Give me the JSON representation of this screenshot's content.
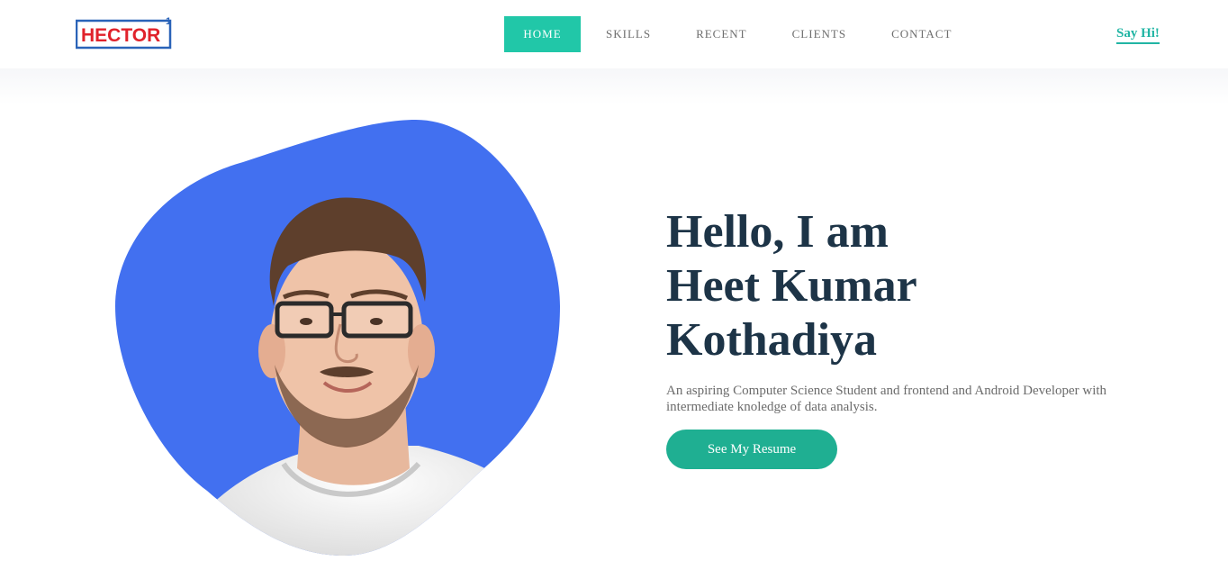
{
  "header": {
    "logo_text": "HECTOR",
    "logo_superscript": "1",
    "nav": [
      {
        "label": "HOME",
        "active": true
      },
      {
        "label": "SKILLS",
        "active": false
      },
      {
        "label": "RECENT",
        "active": false
      },
      {
        "label": "CLIENTS",
        "active": false
      },
      {
        "label": "CONTACT",
        "active": false
      }
    ],
    "say_hi": "Say Hi!"
  },
  "hero": {
    "title_lines": [
      "Hello, I am",
      "Heet Kumar",
      "Kothadiya"
    ],
    "description": "An aspiring Computer Science Student and frontend and Android Developer with intermediate knoledge of data analysis.",
    "resume_button": "See My Resume",
    "photo_icon": "person-photo"
  },
  "colors": {
    "accent": "#21c7a8",
    "button": "#1faf92",
    "blob": "#4270f0",
    "heading": "#1d3447",
    "logo_red": "#e0222b",
    "logo_blue": "#2a63b8"
  }
}
